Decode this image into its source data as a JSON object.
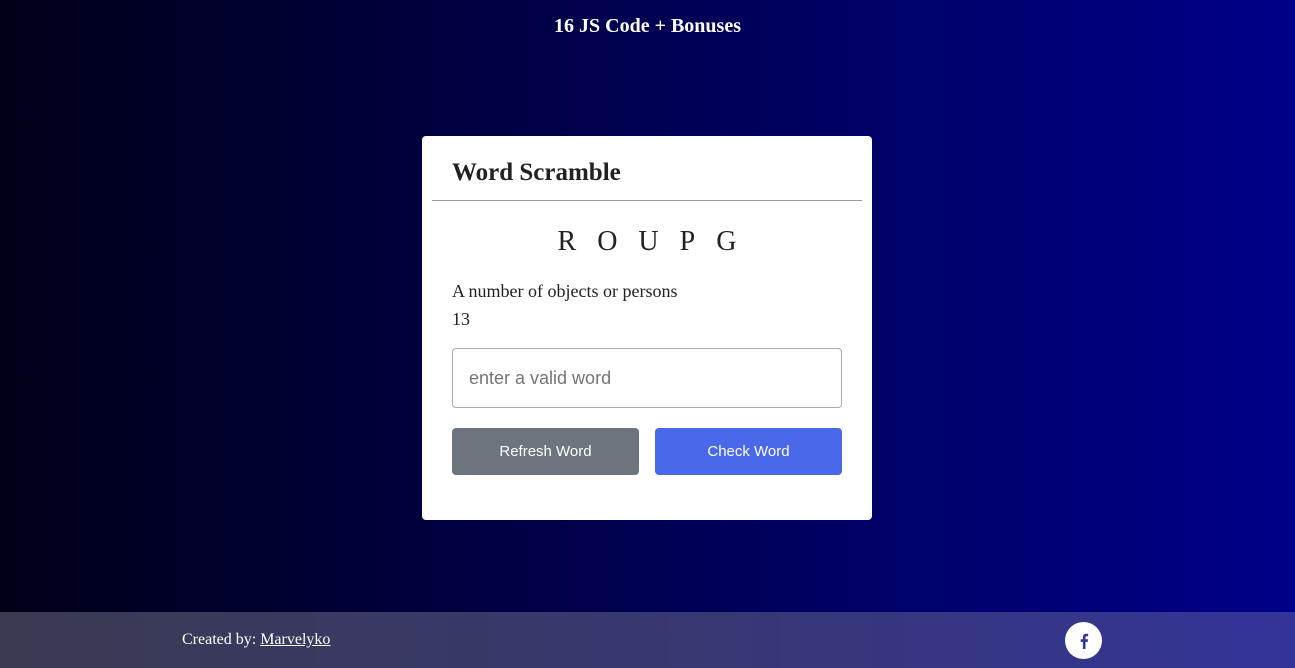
{
  "header": {
    "title": "16 JS Code + Bonuses"
  },
  "game": {
    "title": "Word Scramble",
    "scrambled_word": "ROUPG",
    "hint": "A number of objects or persons",
    "time_left": "13",
    "input": {
      "value": "",
      "placeholder": "enter a valid word"
    },
    "refresh_label": "Refresh Word",
    "check_label": "Check Word"
  },
  "footer": {
    "credit_prefix": "Created by: ",
    "author": "Marvelyko",
    "social_icon": "facebook-icon"
  },
  "colors": {
    "refresh_button": "#6c757d",
    "check_button": "#4a68ea",
    "card_background": "#ffffff",
    "page_background_start": "#000018",
    "page_background_end": "#000088"
  }
}
